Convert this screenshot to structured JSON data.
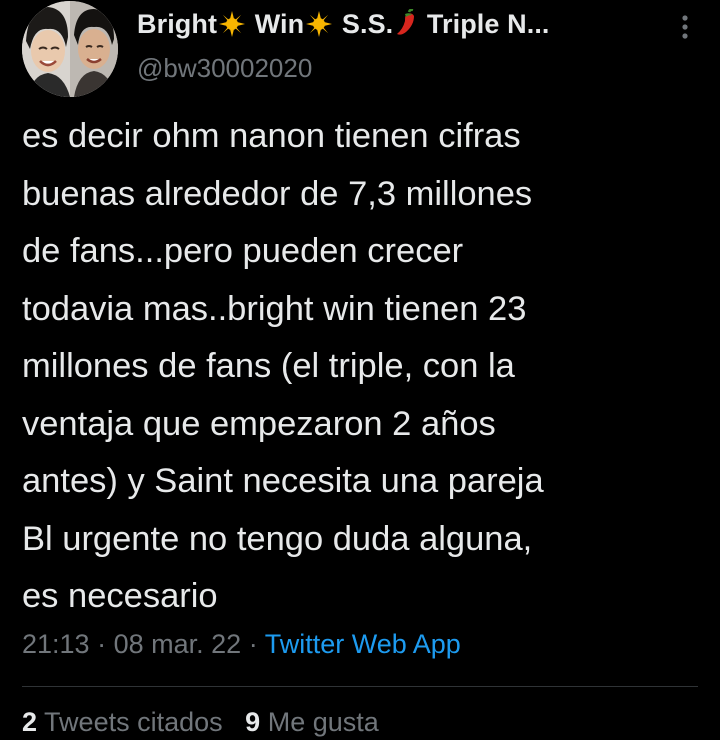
{
  "author": {
    "display_name_parts": [
      "Bright",
      "Win",
      "S.S.",
      "Triple N..."
    ],
    "name_emojis": [
      "sun-icon",
      "sun-icon",
      "chili-pepper-icon"
    ],
    "handle": "@bw30002020",
    "avatar": "two-people-photo"
  },
  "tweet": {
    "lines": [
      "es decir ohm nanon tienen cifras",
      "buenas alrededor de 7,3 millones",
      "de fans...pero pueden crecer",
      "todavia mas..bright win tienen 23",
      "millones de fans (el triple, con la",
      "ventaja que empezaron 2 años",
      "antes) y Saint necesita una pareja",
      "Bl urgente no tengo duda alguna,",
      "es necesario"
    ],
    "time": "21:13",
    "separator": "·",
    "date": "08 mar. 22",
    "source": "Twitter Web App"
  },
  "stats": {
    "quotes_count": "2",
    "quotes_label": "Tweets citados",
    "likes_count": "9",
    "likes_label": "Me gusta"
  },
  "colors": {
    "background": "#000000",
    "text": "#e7e9ea",
    "muted": "#71767b",
    "link": "#1d9bf0"
  },
  "icons": {
    "more": "more-vertical-icon"
  }
}
